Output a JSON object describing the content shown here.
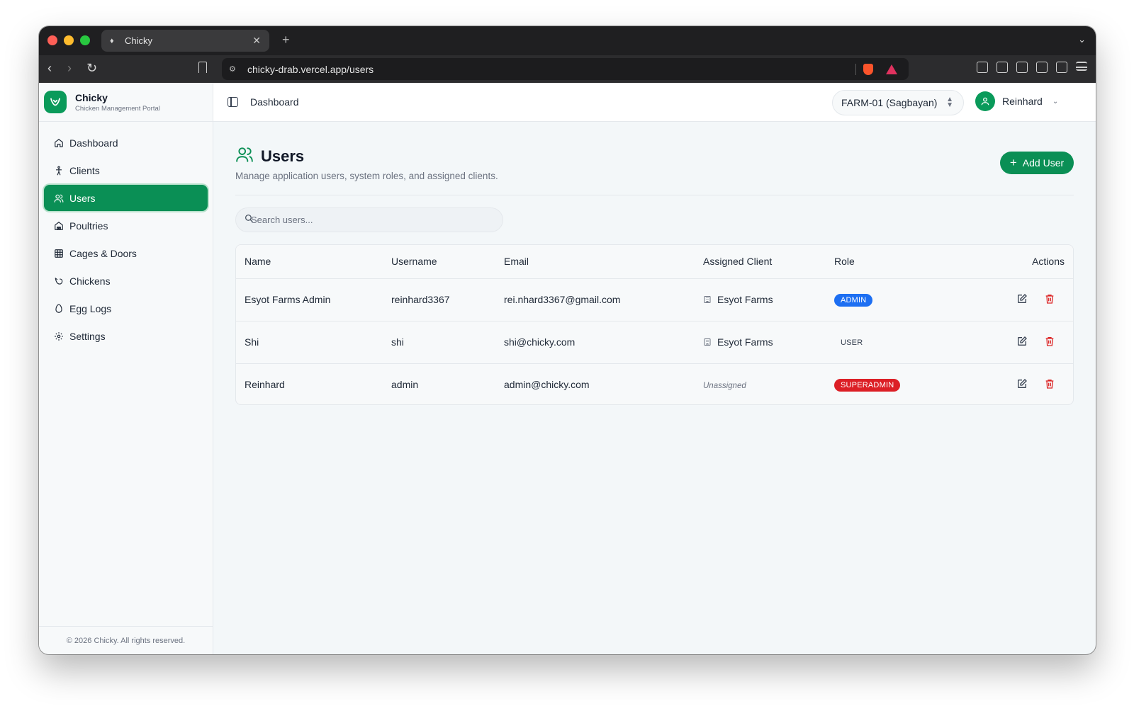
{
  "browser": {
    "tab_title": "Chicky",
    "url": "chicky-drab.vercel.app/users"
  },
  "brand": {
    "name": "Chicky",
    "subtitle": "Chicken Management Portal"
  },
  "sidebar": {
    "items": [
      {
        "label": "Dashboard",
        "icon": "home-icon"
      },
      {
        "label": "Clients",
        "icon": "person-icon"
      },
      {
        "label": "Users",
        "icon": "users-icon",
        "active": true
      },
      {
        "label": "Poultries",
        "icon": "barn-icon"
      },
      {
        "label": "Cages & Doors",
        "icon": "grid-icon"
      },
      {
        "label": "Chickens",
        "icon": "chicken-icon"
      },
      {
        "label": "Egg Logs",
        "icon": "egg-icon"
      },
      {
        "label": "Settings",
        "icon": "gear-icon"
      }
    ],
    "footer": "© 2026 Chicky. All rights reserved."
  },
  "topbar": {
    "breadcrumb": "Dashboard",
    "farm": "FARM-01 (Sagbayan)",
    "user": "Reinhard"
  },
  "page": {
    "title": "Users",
    "description": "Manage application users, system roles, and assigned clients.",
    "add_button": "Add User",
    "search_placeholder": "Search users..."
  },
  "table": {
    "headers": [
      "Name",
      "Username",
      "Email",
      "Assigned Client",
      "Role",
      "Actions"
    ],
    "rows": [
      {
        "name": "Esyot Farms Admin",
        "username": "reinhard3367",
        "email": "rei.nhard3367@gmail.com",
        "client": "Esyot Farms",
        "role": "ADMIN"
      },
      {
        "name": "Shi",
        "username": "shi",
        "email": "shi@chicky.com",
        "client": "Esyot Farms",
        "role": "USER"
      },
      {
        "name": "Reinhard",
        "username": "admin",
        "email": "admin@chicky.com",
        "client": "Unassigned",
        "role": "SUPERADMIN"
      }
    ]
  },
  "colors": {
    "accent": "#0a8f55",
    "admin_badge": "#1d6ff2",
    "superadmin_badge": "#dc1f26",
    "delete": "#dc2626"
  }
}
